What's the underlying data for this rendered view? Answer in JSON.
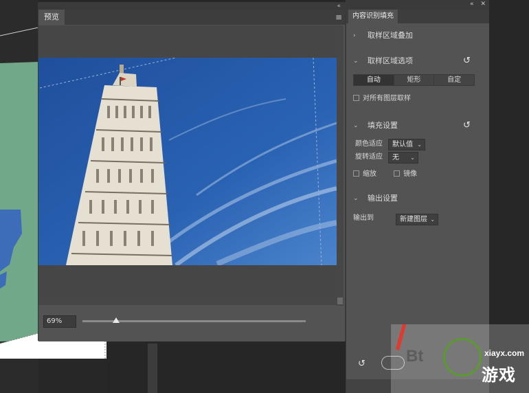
{
  "preview": {
    "tab_label": "预览",
    "zoom_value": "69%",
    "zoom_fraction": 0.15
  },
  "caf": {
    "tab_label": "内容识别填充",
    "sections": {
      "overlay": "取样区域叠加",
      "sampling_options": "取样区域选项",
      "fill_settings": "填充设置",
      "output_settings": "输出设置"
    },
    "segments": [
      "自动",
      "矩形",
      "自定"
    ],
    "active_segment": "自动",
    "sample_all_layers": "对所有图层取样",
    "color_adapt_label": "颜色适应",
    "color_adapt_value": "默认值",
    "rotation_adapt_label": "旋转适应",
    "rotation_adapt_value": "无",
    "scale_label": "缩放",
    "mirror_label": "镜像",
    "output_to_label": "输出到",
    "output_to_value": "新建图层"
  },
  "watermark": {
    "domain": "xiayx.com",
    "brand": "游戏",
    "bt": "Bt"
  },
  "icons": {
    "collapse": "«",
    "close": "✕",
    "menu": "≡",
    "chevron_right": "›",
    "chevron_down": "⌄",
    "reset": "↺",
    "caret": "⌄"
  }
}
